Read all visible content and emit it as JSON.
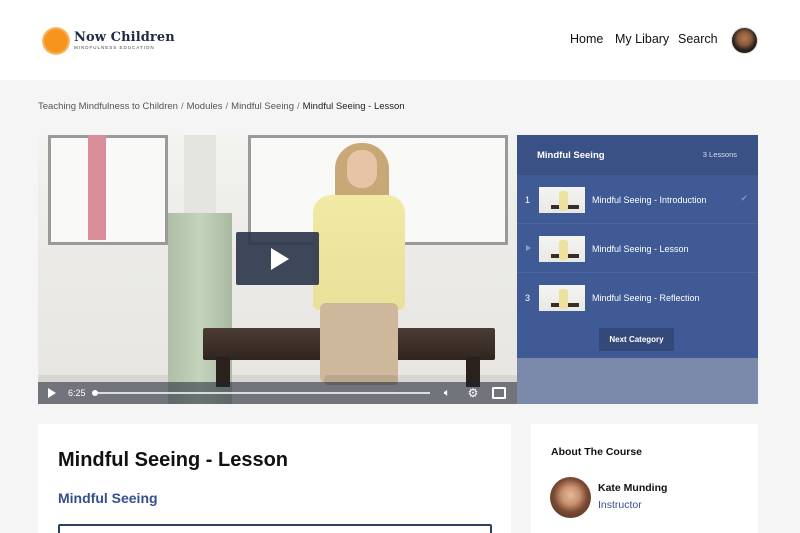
{
  "brand": {
    "name": "Now Children",
    "tagline": "MINDFULNESS EDUCATION"
  },
  "nav": {
    "home": "Home",
    "library": "My Libary",
    "search": "Search"
  },
  "breadcrumb": {
    "items": [
      "Teaching Mindfulness to Children",
      "Modules",
      "Mindful Seeing"
    ],
    "current": "Mindful Seeing - Lesson",
    "separator": "/"
  },
  "video": {
    "time": "6:25",
    "progress": 0.0
  },
  "lessons_panel": {
    "title": "Mindful Seeing",
    "count": "3 Lessons",
    "items": [
      {
        "num": "1",
        "title": "Mindful Seeing - Introduction",
        "completed": true
      },
      {
        "num": "",
        "title": "Mindful Seeing - Lesson",
        "current": true
      },
      {
        "num": "3",
        "title": "Mindful Seeing - Reflection"
      }
    ],
    "next_label": "Next Category"
  },
  "main": {
    "title": "Mindful Seeing - Lesson",
    "subtitle": "Mindful Seeing"
  },
  "about": {
    "title": "About The Course",
    "instructor_name": "Kate Munding",
    "instructor_role": "Instructor"
  },
  "colors": {
    "accent": "#3f5a95",
    "brand_orange": "#f7941d",
    "link": "#34508c"
  }
}
